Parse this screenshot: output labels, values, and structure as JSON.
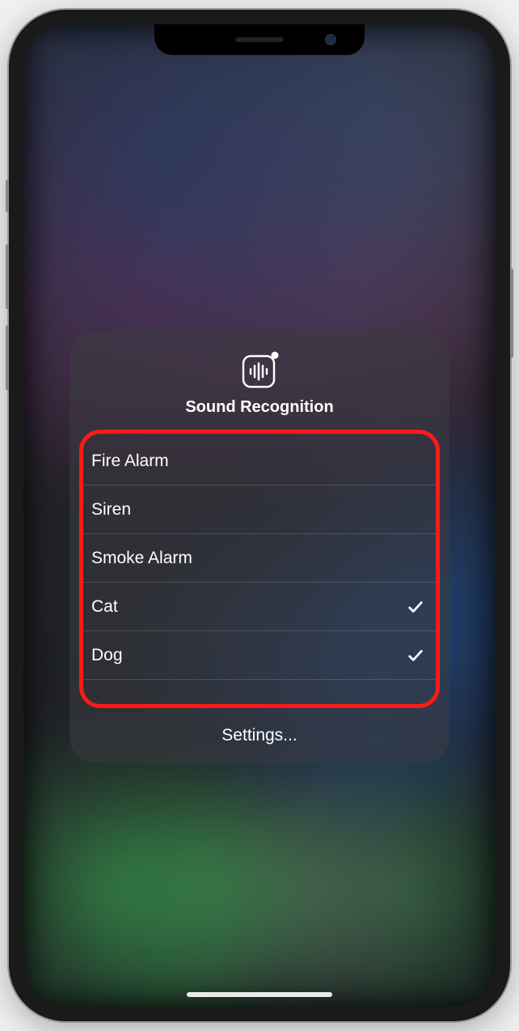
{
  "panel": {
    "title": "Sound Recognition",
    "items": [
      {
        "label": "Fire Alarm",
        "checked": false
      },
      {
        "label": "Siren",
        "checked": false
      },
      {
        "label": "Smoke Alarm",
        "checked": false
      },
      {
        "label": "Cat",
        "checked": true
      },
      {
        "label": "Dog",
        "checked": true
      }
    ],
    "settings_label": "Settings..."
  }
}
